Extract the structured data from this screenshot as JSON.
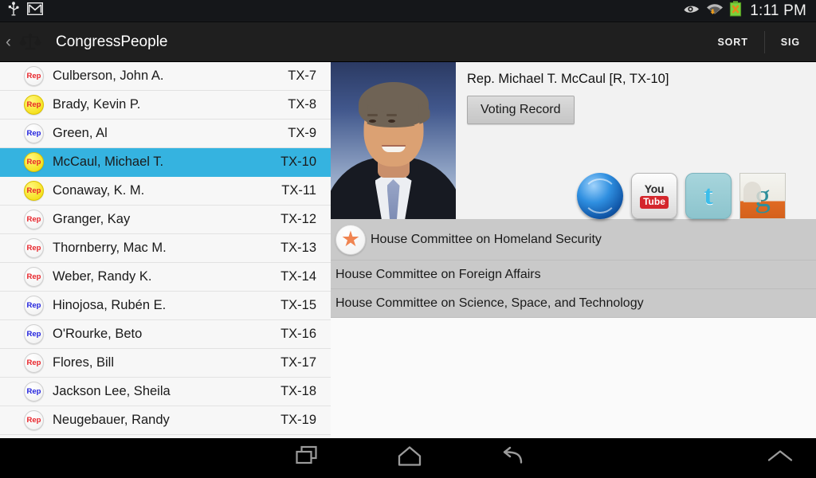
{
  "statusbar": {
    "icons": [
      "usb-icon",
      "gmail-icon"
    ],
    "right_icons": [
      "eye-icon",
      "wifi-download-icon",
      "battery-error-icon"
    ],
    "clock": "1:11 PM"
  },
  "actionbar": {
    "up_caret": "‹",
    "logo_icon": "scales-of-justice-icon",
    "title": "CongressPeople",
    "sort_label": "SORT",
    "sig_label": "SIG"
  },
  "list": {
    "rows": [
      {
        "badge": "Rep",
        "badge_fill": "white",
        "badge_text_color": "red",
        "name": "Culberson, John A.",
        "district": "TX-7",
        "selected": false
      },
      {
        "badge": "Rep",
        "badge_fill": "yellow",
        "badge_text_color": "red",
        "name": "Brady, Kevin P.",
        "district": "TX-8",
        "selected": false
      },
      {
        "badge": "Rep",
        "badge_fill": "white",
        "badge_text_color": "blue",
        "name": "Green, Al",
        "district": "TX-9",
        "selected": false
      },
      {
        "badge": "Rep",
        "badge_fill": "yellow",
        "badge_text_color": "red",
        "name": "McCaul, Michael T.",
        "district": "TX-10",
        "selected": true
      },
      {
        "badge": "Rep",
        "badge_fill": "yellow",
        "badge_text_color": "red",
        "name": "Conaway, K. M.",
        "district": "TX-11",
        "selected": false
      },
      {
        "badge": "Rep",
        "badge_fill": "white",
        "badge_text_color": "red",
        "name": "Granger, Kay",
        "district": "TX-12",
        "selected": false
      },
      {
        "badge": "Rep",
        "badge_fill": "white",
        "badge_text_color": "red",
        "name": "Thornberry, Mac M.",
        "district": "TX-13",
        "selected": false
      },
      {
        "badge": "Rep",
        "badge_fill": "white",
        "badge_text_color": "red",
        "name": "Weber, Randy K.",
        "district": "TX-14",
        "selected": false
      },
      {
        "badge": "Rep",
        "badge_fill": "white",
        "badge_text_color": "blue",
        "name": "Hinojosa, Rubén E.",
        "district": "TX-15",
        "selected": false
      },
      {
        "badge": "Rep",
        "badge_fill": "white",
        "badge_text_color": "blue",
        "name": "O'Rourke, Beto",
        "district": "TX-16",
        "selected": false
      },
      {
        "badge": "Rep",
        "badge_fill": "white",
        "badge_text_color": "red",
        "name": "Flores, Bill",
        "district": "TX-17",
        "selected": false
      },
      {
        "badge": "Rep",
        "badge_fill": "white",
        "badge_text_color": "blue",
        "name": "Jackson Lee, Sheila",
        "district": "TX-18",
        "selected": false
      },
      {
        "badge": "Rep",
        "badge_fill": "white",
        "badge_text_color": "red",
        "name": "Neugebauer, Randy",
        "district": "TX-19",
        "selected": false
      }
    ]
  },
  "detail": {
    "photo_alt": "portrait-photo",
    "title": "Rep. Michael T. McCaul [R, TX-10]",
    "voting_record_label": "Voting Record",
    "links": [
      {
        "icon": "website-globe-icon",
        "label": ""
      },
      {
        "icon": "youtube-icon",
        "label_top": "You",
        "label_bottom": "Tube"
      },
      {
        "icon": "twitter-icon",
        "label": "t"
      },
      {
        "icon": "govtrack-icon",
        "label": "g"
      }
    ],
    "committees": [
      {
        "name": "House Committee on Homeland Security",
        "leadership_star": true
      },
      {
        "name": "House Committee on Foreign Affairs",
        "leadership_star": false
      },
      {
        "name": "House Committee on Science, Space, and Technology",
        "leadership_star": false
      }
    ]
  },
  "navbar": {
    "buttons": [
      "recent-apps-icon",
      "home-icon",
      "back-icon",
      "expand-chevron-up-icon"
    ]
  },
  "colors": {
    "selected_row": "#35b3e0",
    "committee_bg": "#c9c9c9",
    "star": "#f08451",
    "rep_red": "#e8242a",
    "rep_blue": "#2222dd"
  }
}
